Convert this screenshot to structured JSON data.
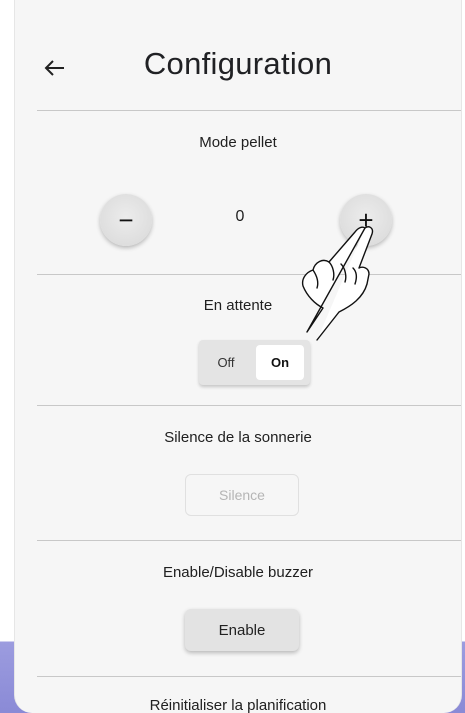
{
  "header": {
    "title": "Configuration",
    "back_icon": "arrow-left-icon"
  },
  "pellet_mode": {
    "label": "Mode pellet",
    "value": "0",
    "decrement_label": "−",
    "increment_label": "+"
  },
  "standby": {
    "label": "En attente",
    "off_label": "Off",
    "on_label": "On",
    "selected": "On"
  },
  "ringer_silence": {
    "label": "Silence de la sonnerie",
    "button_label": "Silence"
  },
  "buzzer": {
    "label": "Enable/Disable buzzer",
    "button_label": "Enable"
  },
  "reset_schedule": {
    "label": "Réinitialiser la planification"
  },
  "overlay": {
    "icon": "pointing-hand-icon"
  }
}
